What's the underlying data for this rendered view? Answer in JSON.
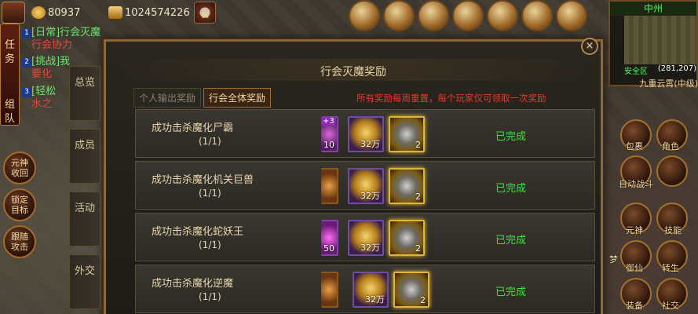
{
  "topbar": {
    "gold": "80937",
    "ingot": "1024574226",
    "skull_label": "挑"
  },
  "quest_panel": {
    "tab_label": "任务",
    "team_label": "组队",
    "items": [
      {
        "num": "1",
        "line1": "[日常]行会灭魔",
        "line2": "行会协力"
      },
      {
        "num": "2",
        "line1": "[挑战]我",
        "line2": "要化"
      },
      {
        "num": "3",
        "line1": "[轻松",
        "line2": "水之"
      }
    ]
  },
  "left_buttons": {
    "recall": "元神收回",
    "target": "锁定目标",
    "follow": "跟随攻击"
  },
  "minimap": {
    "region": "中州",
    "safe_zone": "安全区",
    "coords": "(281,207)",
    "sub": "九重云霄(中级)"
  },
  "modal": {
    "title": "行会灭魔奖励",
    "close_label": "×",
    "side_tabs": [
      "总览",
      "成员",
      "活动",
      "外交"
    ],
    "tabs": [
      {
        "label": "个人输出奖励",
        "active": false
      },
      {
        "label": "行会全体奖励",
        "active": true
      }
    ],
    "notice": "所有奖励每周重置，每个玩家仅可领取一次奖励",
    "rows": [
      {
        "name": "成功击杀魔化尸霸",
        "progress": "(1/1)",
        "status": "已完成",
        "rewards": [
          {
            "type": "partial-purple",
            "qty": "10",
            "badge": "+3"
          },
          {
            "type": "gold",
            "qty": "32万"
          },
          {
            "type": "stone",
            "qty": "2"
          }
        ]
      },
      {
        "name": "成功击杀魔化机关巨兽",
        "progress": "(1/1)",
        "status": "已完成",
        "rewards": [
          {
            "type": "partial-orange",
            "qty": ""
          },
          {
            "type": "gold",
            "qty": "32万"
          },
          {
            "type": "stone",
            "qty": "2"
          }
        ]
      },
      {
        "name": "成功击杀魔化蛇妖王",
        "progress": "(1/1)",
        "status": "已完成",
        "rewards": [
          {
            "type": "partial-pink",
            "qty": "50"
          },
          {
            "type": "gold",
            "qty": "32万"
          },
          {
            "type": "stone",
            "qty": "2"
          }
        ]
      },
      {
        "name": "成功击杀魔化逆魔",
        "progress": "(1/1)",
        "status": "已完成",
        "rewards": [
          {
            "type": "partial-orange",
            "qty": ""
          },
          {
            "type": "gold",
            "qty": "32万"
          },
          {
            "type": "stone",
            "qty": "2"
          }
        ]
      }
    ]
  },
  "right_buttons": {
    "bag": "包裹",
    "role": "角色",
    "auto_battle": "自动战斗",
    "skill": "技能",
    "element": "元神",
    "dream": "梦",
    "royal": "御仙",
    "rebirth": "转生",
    "equip": "装备",
    "social": "社交"
  }
}
